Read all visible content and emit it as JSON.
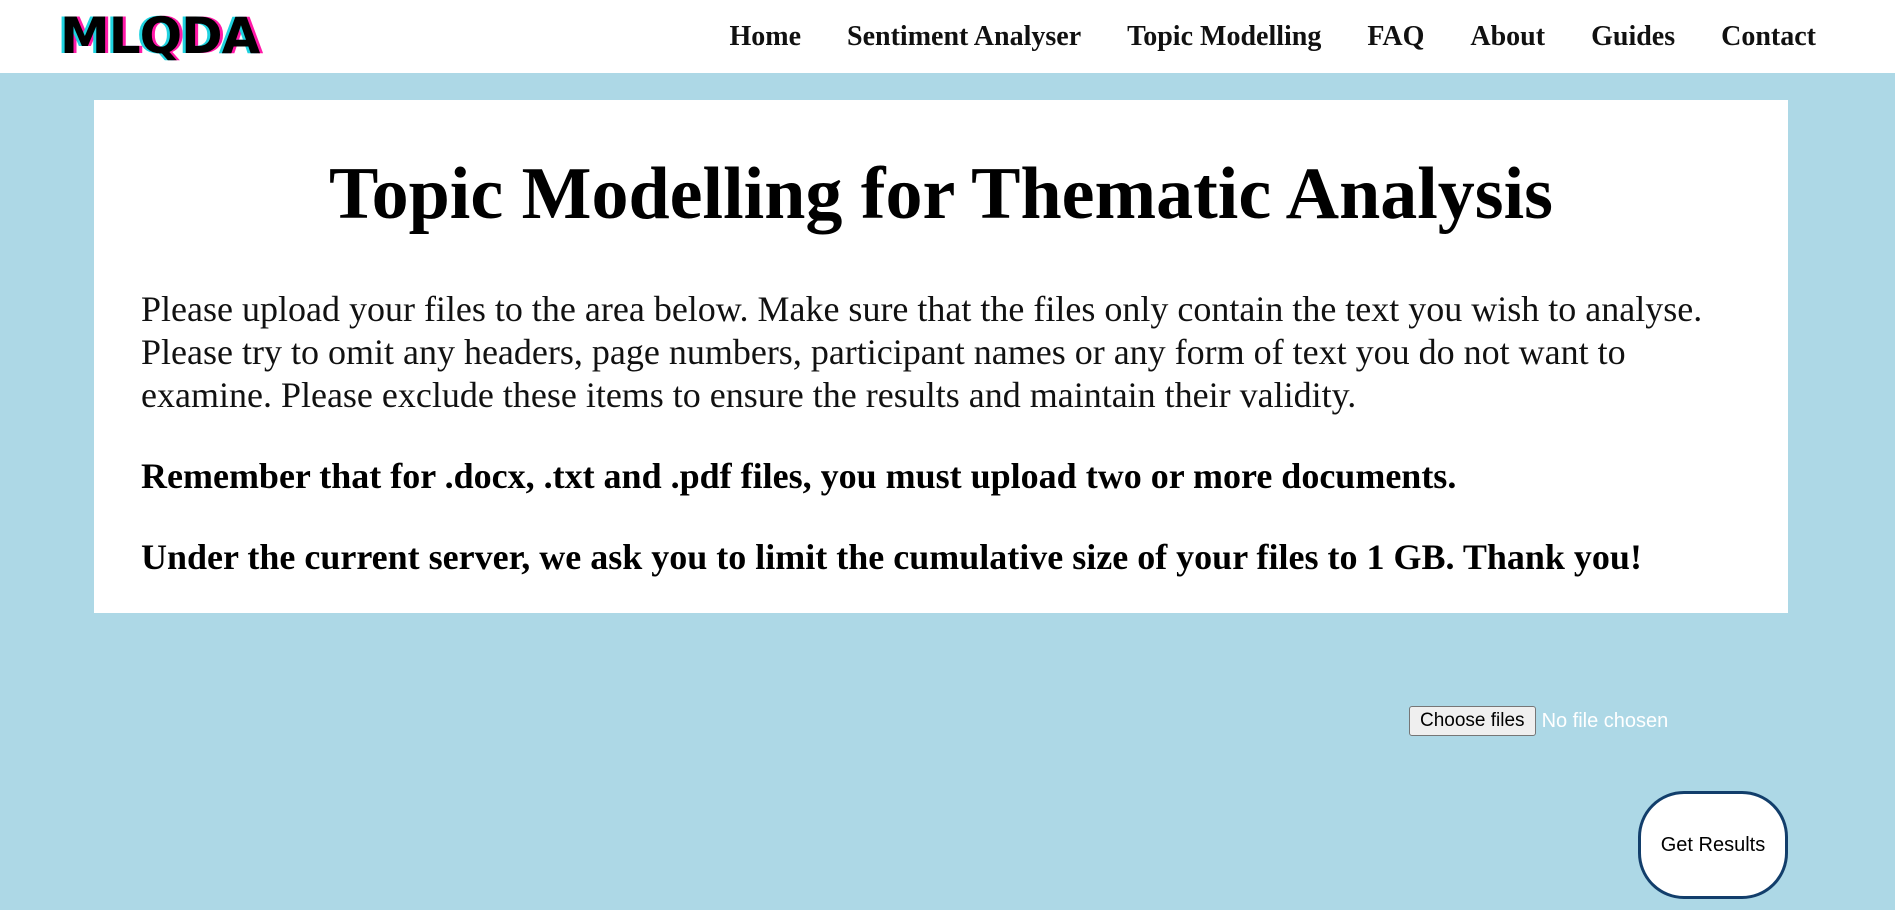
{
  "header": {
    "logo_text": "MLQDA",
    "logo_colors": {
      "shadow_left": "#1fd3e0",
      "shadow_right": "#ff1aa8"
    },
    "nav": [
      {
        "label": "Home"
      },
      {
        "label": "Sentiment Analyser"
      },
      {
        "label": "Topic Modelling"
      },
      {
        "label": "FAQ"
      },
      {
        "label": "About"
      },
      {
        "label": "Guides"
      },
      {
        "label": "Contact"
      }
    ]
  },
  "main": {
    "title": "Topic Modelling for Thematic Analysis",
    "intro": "Please upload your files to the area below. Make sure that the files only contain the text you wish to analyse. Please try to omit any headers, page numbers, participant names or any form of text you do not want to examine. Please exclude these items to ensure the results and maintain their validity.",
    "note_formats": "Remember that for .docx, .txt and .pdf files, you must upload two or more documents.",
    "note_size": "Under the current server, we ask you to limit the cumulative size of your files to 1 GB. Thank you!"
  },
  "upload": {
    "choose_label": "Choose files",
    "status": "No file chosen"
  },
  "actions": {
    "get_results_label": "Get Results"
  },
  "colors": {
    "page_background": "#add8e6",
    "card_background": "#ffffff",
    "button_border": "#123e6b"
  }
}
